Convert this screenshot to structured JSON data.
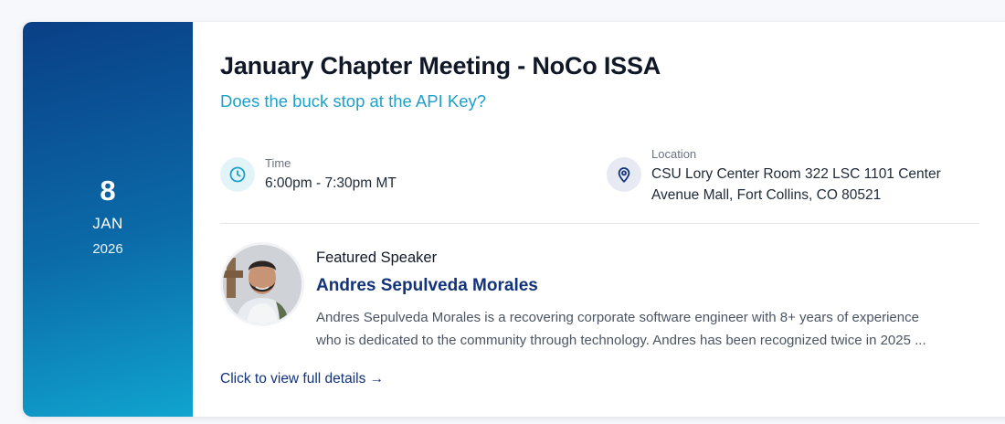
{
  "event": {
    "date": {
      "day": "8",
      "month": "JAN",
      "year": "2026"
    },
    "title": "January Chapter Meeting - NoCo ISSA",
    "subtitle": "Does the buck stop at the API Key?",
    "time": {
      "label": "Time",
      "value": "6:00pm - 7:30pm MT",
      "icon": "clock-icon"
    },
    "location": {
      "label": "Location",
      "value": "CSU Lory Center Room 322 LSC 1101 Center Avenue Mall, Fort Collins, CO 80521",
      "icon": "map-pin-icon"
    },
    "speaker": {
      "label": "Featured Speaker",
      "name": "Andres Sepulveda Morales",
      "bio_lines": [
        "Andres Sepulveda Morales is a recovering corporate software engineer with 8+ years of experience",
        "who is dedicated to the community through technology. Andres has been recognized twice in 2025 ..."
      ]
    },
    "details_link": "Click to view full details →"
  },
  "colors": {
    "date_gradient_start": "#0a3f86",
    "date_gradient_end": "#10a4cf",
    "subtitle": "#1ea0c8",
    "speaker_name": "#12337a",
    "link": "#12337a"
  }
}
